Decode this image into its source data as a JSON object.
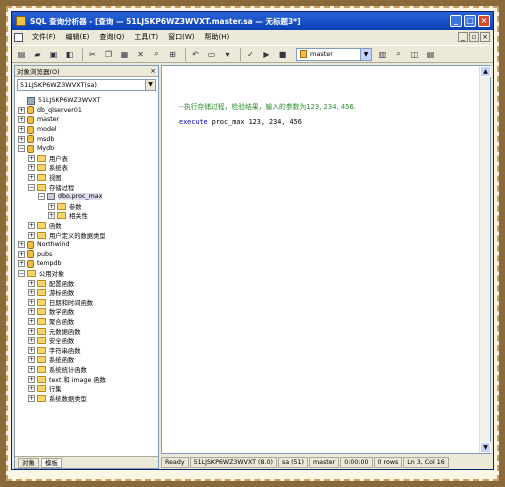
{
  "window": {
    "title": "SQL 查询分析器 - [查询 — 51LJSKP6WZ3WVXT.master.sa — 无标题3*]"
  },
  "menu": {
    "items": [
      "文件(F)",
      "编辑(E)",
      "查询(Q)",
      "工具(T)",
      "窗口(W)",
      "帮助(H)"
    ]
  },
  "toolbar": {
    "database": "master"
  },
  "explorer": {
    "title": "对象浏览器(O)",
    "server_select": "51LJSKP6WZ3WVXT(sa)",
    "tabs": [
      "对象",
      "模板"
    ],
    "tree": [
      {
        "level": 0,
        "pm": "",
        "icon": "server",
        "label": "51LJSKP6WZ3WVXT"
      },
      {
        "level": 0,
        "pm": "+",
        "icon": "db",
        "label": "db_qlserver01"
      },
      {
        "level": 0,
        "pm": "+",
        "icon": "db",
        "label": "master"
      },
      {
        "level": 0,
        "pm": "+",
        "icon": "db",
        "label": "model"
      },
      {
        "level": 0,
        "pm": "+",
        "icon": "db",
        "label": "msdb"
      },
      {
        "level": 0,
        "pm": "-",
        "icon": "db",
        "label": "Mydb"
      },
      {
        "level": 1,
        "pm": "+",
        "icon": "folder",
        "label": "用户表"
      },
      {
        "level": 1,
        "pm": "+",
        "icon": "folder",
        "label": "系统表"
      },
      {
        "level": 1,
        "pm": "+",
        "icon": "folder",
        "label": "视图"
      },
      {
        "level": 1,
        "pm": "-",
        "icon": "folder",
        "label": "存储过程"
      },
      {
        "level": 2,
        "pm": "-",
        "icon": "proc",
        "label": "dbo.proc_max"
      },
      {
        "level": 3,
        "pm": "+",
        "icon": "folder",
        "label": "参数"
      },
      {
        "level": 3,
        "pm": "+",
        "icon": "folder",
        "label": "相关性"
      },
      {
        "level": 1,
        "pm": "+",
        "icon": "folder",
        "label": "函数"
      },
      {
        "level": 1,
        "pm": "+",
        "icon": "folder",
        "label": "用户定义的数据类型"
      },
      {
        "level": 0,
        "pm": "+",
        "icon": "db",
        "label": "Northwind"
      },
      {
        "level": 0,
        "pm": "+",
        "icon": "db",
        "label": "pubs"
      },
      {
        "level": 0,
        "pm": "+",
        "icon": "db",
        "label": "tempdb"
      },
      {
        "level": 0,
        "pm": "-",
        "icon": "folder",
        "label": "公用对象"
      },
      {
        "level": 1,
        "pm": "+",
        "icon": "folder",
        "label": "配置函数"
      },
      {
        "level": 1,
        "pm": "+",
        "icon": "folder",
        "label": "游标函数"
      },
      {
        "level": 1,
        "pm": "+",
        "icon": "folder",
        "label": "日期和时间函数"
      },
      {
        "level": 1,
        "pm": "+",
        "icon": "folder",
        "label": "数学函数"
      },
      {
        "level": 1,
        "pm": "+",
        "icon": "folder",
        "label": "聚合函数"
      },
      {
        "level": 1,
        "pm": "+",
        "icon": "folder",
        "label": "元数据函数"
      },
      {
        "level": 1,
        "pm": "+",
        "icon": "folder",
        "label": "安全函数"
      },
      {
        "level": 1,
        "pm": "+",
        "icon": "folder",
        "label": "字符串函数"
      },
      {
        "level": 1,
        "pm": "+",
        "icon": "folder",
        "label": "系统函数"
      },
      {
        "level": 1,
        "pm": "+",
        "icon": "folder",
        "label": "系统统计函数"
      },
      {
        "level": 1,
        "pm": "+",
        "icon": "folder",
        "label": "text 和 image 函数"
      },
      {
        "level": 1,
        "pm": "+",
        "icon": "folder",
        "label": "行集"
      },
      {
        "level": 1,
        "pm": "+",
        "icon": "folder",
        "label": "系统数据类型"
      }
    ]
  },
  "editor": {
    "comment": "--执行存储过程，检验结果，输入的参数为123, 234, 456.",
    "code_keyword": "execute",
    "code_proc": "proc_max",
    "code_args": "123, 234, 456"
  },
  "statusbar": {
    "cells": [
      "Ready",
      "51LJSKP6WZ3WVXT (8.0)",
      "sa (51)",
      "master",
      "0:00:00",
      "0 rows",
      "Ln 3, Col 16"
    ]
  }
}
